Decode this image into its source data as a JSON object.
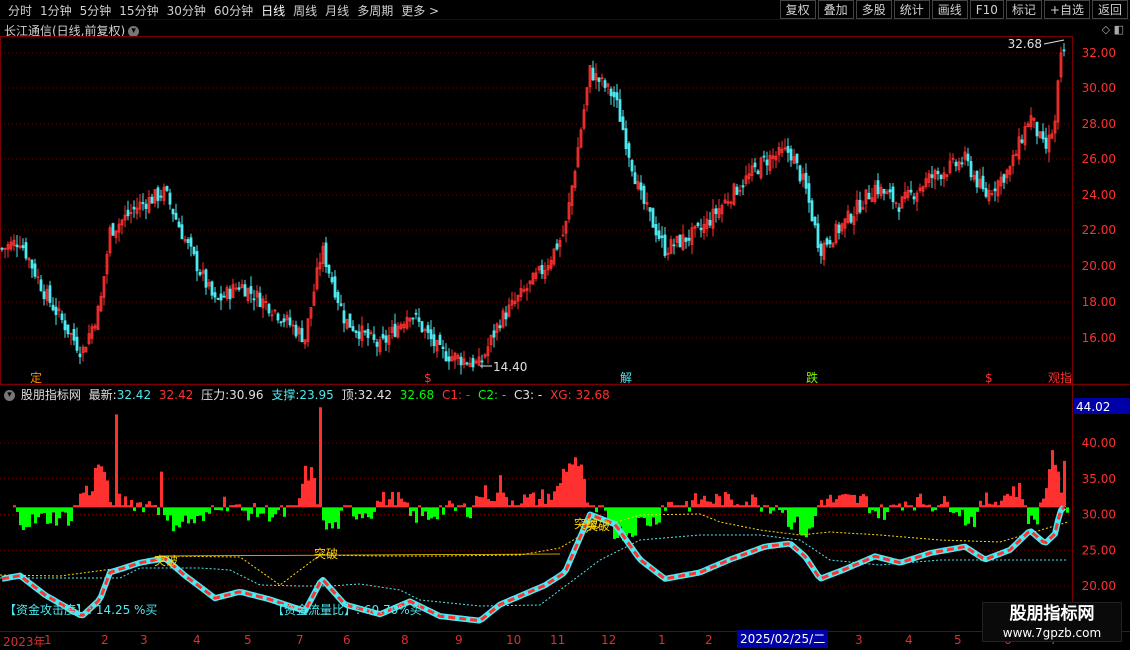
{
  "toolbar": {
    "periods": [
      "分时",
      "1分钟",
      "5分钟",
      "15分钟",
      "30分钟",
      "60分钟",
      "日线",
      "周线",
      "月线",
      "多周期",
      "更多 >"
    ],
    "active_period": "日线",
    "actions": [
      "复权",
      "叠加",
      "多股",
      "统计",
      "画线",
      "F10",
      "标记",
      "+自选",
      "返回"
    ]
  },
  "chart": {
    "title": "长江通信(日线,前复权)",
    "price_labels": [
      "32.00",
      "30.00",
      "28.00",
      "26.00",
      "24.00",
      "22.00",
      "20.00",
      "18.00",
      "16.00"
    ],
    "max_label": "32.68",
    "min_label": "14.40",
    "signal_labels": [
      {
        "text": "定",
        "color": "#ff8c00"
      },
      {
        "text": "$",
        "color": "#ff3030"
      },
      {
        "text": "解",
        "color": "#4ee9f0"
      },
      {
        "text": "跌",
        "color": "#7cfc00"
      },
      {
        "text": "$",
        "color": "#ff3030"
      },
      {
        "text": "观指",
        "color": "#ff3030"
      }
    ]
  },
  "indicator": {
    "name": "股朋指标网",
    "latest_label": "最新:",
    "latest_value": "32.42",
    "value2": "32.42",
    "pressure_label": "压力:",
    "pressure_value": "30.96",
    "support_label": "支撑:",
    "support_value": "23.95",
    "top_label": "顶:",
    "top_value": "32.42",
    "val5": "32.68",
    "c1": "C1: -",
    "c2": "C2: -",
    "c3": "C3: -",
    "xg": "XG: 32.68",
    "current_box": "44.02",
    "axis_labels": [
      "40.00",
      "35.00",
      "30.00",
      "25.00",
      "20.00"
    ],
    "break_labels": [
      "突破",
      "突破",
      "突破",
      "突破"
    ],
    "note1": "【资金攻击度】:  14.25 %买",
    "note2": "【资金流量比】:  60.70%买"
  },
  "xaxis": {
    "labels": [
      "2023年",
      "1",
      "2",
      "3",
      "4",
      "5",
      "6",
      "7",
      "8",
      "9",
      "10",
      "11",
      "12",
      "1",
      "2",
      "3",
      "4",
      "5",
      "6",
      "7"
    ],
    "selected_date": "2025/02/25/二"
  },
  "watermark": {
    "title": "股朋指标网",
    "url": "www.7gpzb.com"
  },
  "colors": {
    "up": "#ff3030",
    "down": "#4ee9f0",
    "green": "#00ff00",
    "yellow": "#ffd700",
    "grid": "#7a0000"
  }
}
